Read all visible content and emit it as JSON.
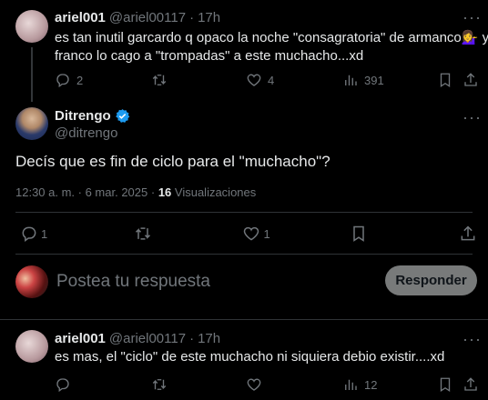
{
  "reply1": {
    "name": "ariel001",
    "handle": "@ariel00117",
    "sep": "·",
    "time": "17h",
    "text_line1": "es tan inutil garcardo q opaco la noche \"consagratoria\" de armanco💁‍♀️ yo q",
    "text_line2": "franco lo cago a \"trompadas\"  a este muchacho...xd",
    "replies": "2",
    "retweets": "",
    "likes": "4",
    "views": "391"
  },
  "main": {
    "name": "Ditrengo",
    "handle": "@ditrengo",
    "text": "Decís que es fin de ciclo para el \"muchacho\"?",
    "timestamp": "12:30 a. m. · 6 mar. 2025 · ",
    "views_count": "16",
    "views_label": " Visualizaciones",
    "replies": "1",
    "retweets": "",
    "likes": "1"
  },
  "compose": {
    "placeholder": "Postea tu respuesta",
    "button": "Responder"
  },
  "reply2": {
    "name": "ariel001",
    "handle": "@ariel00117",
    "sep": "·",
    "time": "17h",
    "text": "es mas, el \"ciclo\" de este muchacho ni siquiera debio existir....xd",
    "replies": "",
    "retweets": "",
    "likes": "",
    "views": "12"
  },
  "icons": {
    "reply": "reply-icon",
    "retweet": "retweet-icon",
    "like": "heart-icon",
    "views": "views-icon",
    "bookmark": "bookmark-icon",
    "share": "share-icon",
    "verified": "verified-badge-icon",
    "more": "more-icon"
  },
  "colors": {
    "background": "#000000",
    "text": "#e7e9ea",
    "muted": "#71767b",
    "verified": "#1d9bf0",
    "button": "#787a7a"
  }
}
